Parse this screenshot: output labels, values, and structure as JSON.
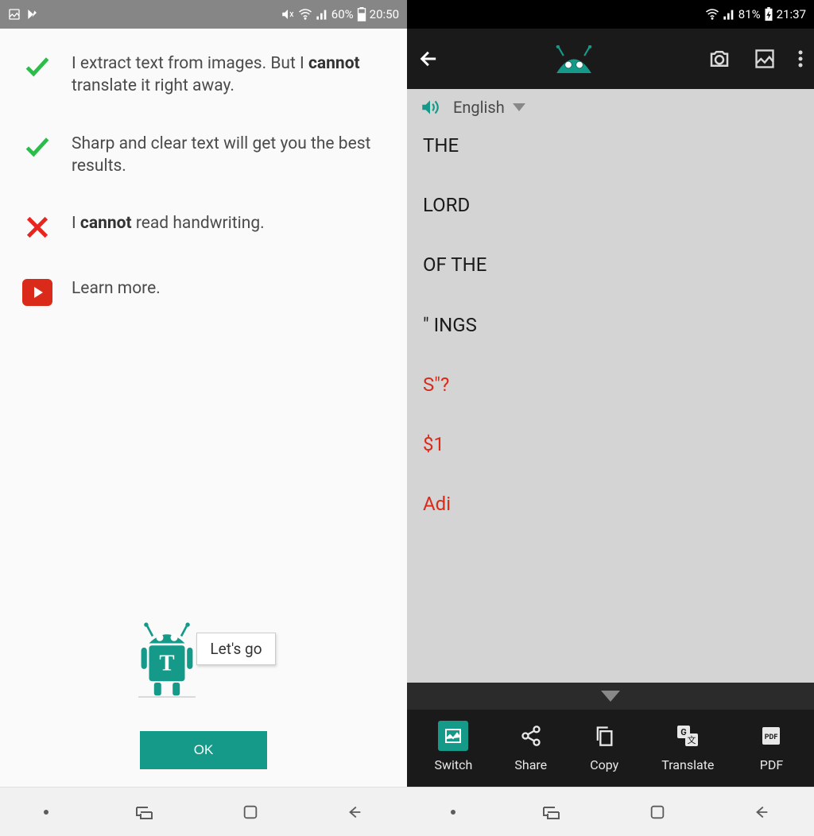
{
  "left": {
    "status": {
      "battery_pct": "60%",
      "time": "20:50"
    },
    "features": [
      {
        "type": "check",
        "pre": "I extract text from images. But I ",
        "bold": "cannot",
        "post": " translate it right away."
      },
      {
        "type": "check",
        "pre": "Sharp and clear text will get you the best results.",
        "bold": "",
        "post": ""
      },
      {
        "type": "cross",
        "pre": "I ",
        "bold": "cannot",
        "post": " read handwriting."
      },
      {
        "type": "youtube",
        "pre": "Learn more.",
        "bold": "",
        "post": ""
      }
    ],
    "speech": "Let's go",
    "ok_label": "OK"
  },
  "right": {
    "status": {
      "battery_pct": "81%",
      "time": "21:37"
    },
    "language": "English",
    "text_lines": [
      {
        "t": "THE",
        "red": false
      },
      {
        "t": "LORD",
        "red": false
      },
      {
        "t": "OF THE",
        "red": false
      },
      {
        "t": "\" INGS",
        "red": false
      },
      {
        "t": "S\"?",
        "red": true
      },
      {
        "t": "$1",
        "red": true
      },
      {
        "t": "Adi",
        "red": true
      }
    ],
    "actions": {
      "switch": "Switch",
      "share": "Share",
      "copy": "Copy",
      "translate": "Translate",
      "pdf": "PDF"
    }
  }
}
